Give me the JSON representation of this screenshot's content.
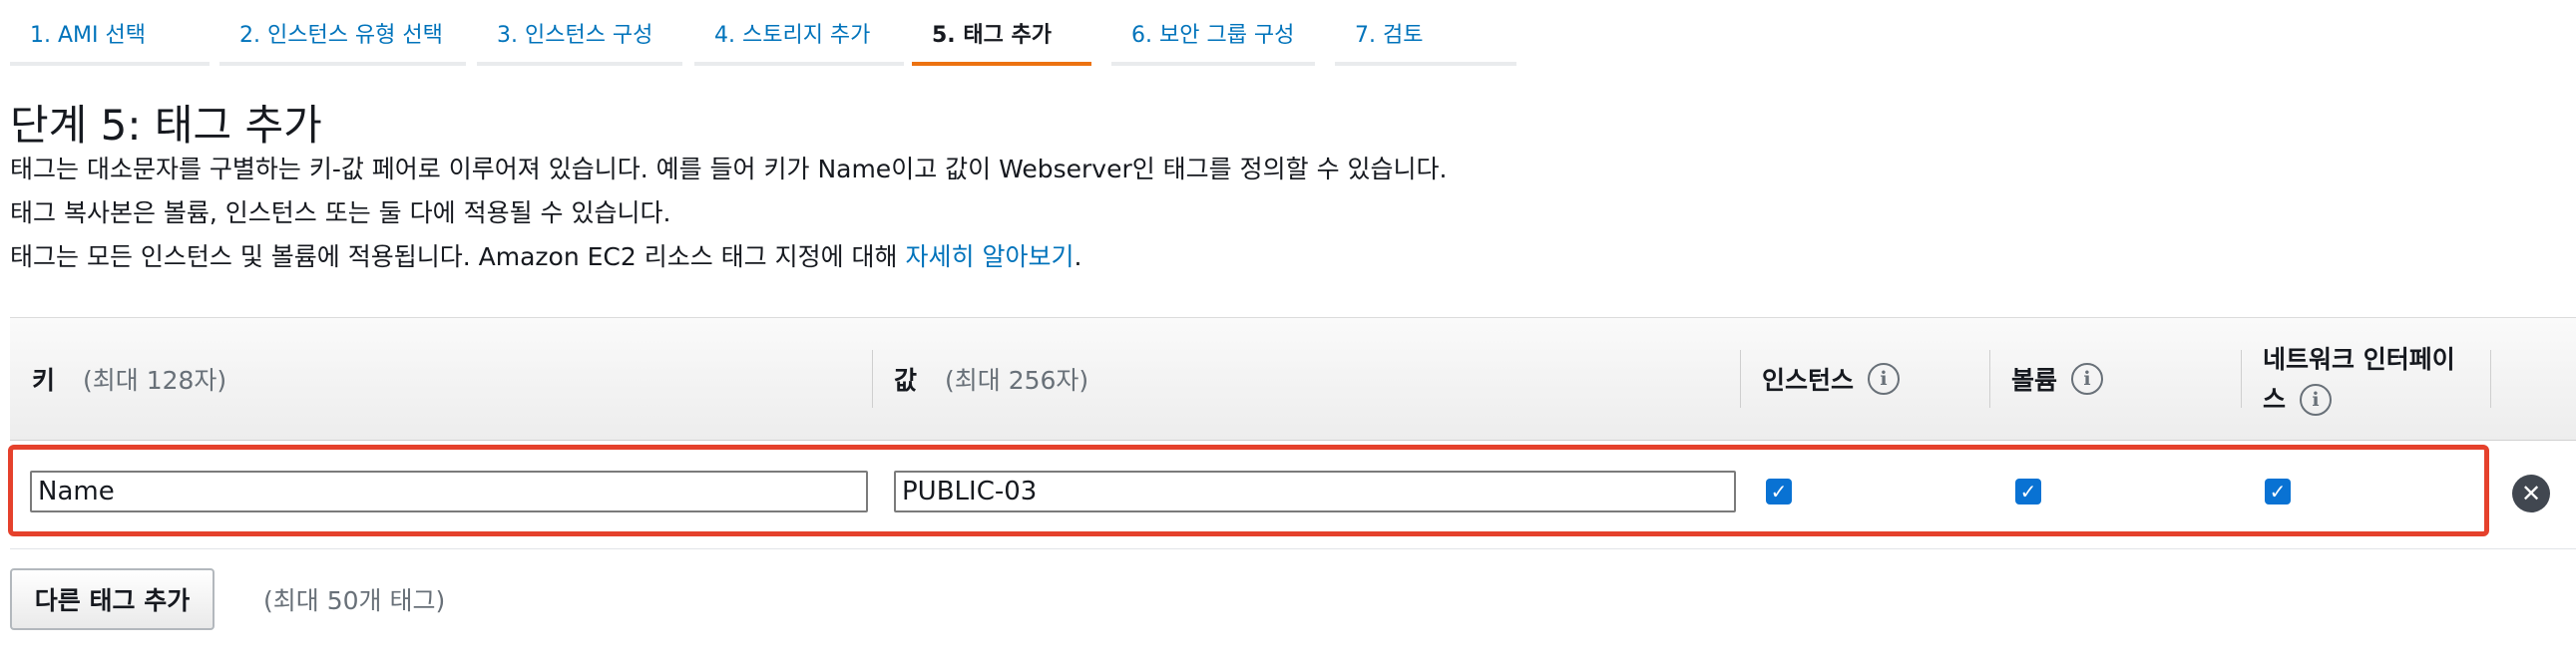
{
  "wizard": {
    "steps": [
      {
        "label": "1. AMI 선택"
      },
      {
        "label": "2. 인스턴스 유형 선택"
      },
      {
        "label": "3. 인스턴스 구성"
      },
      {
        "label": "4. 스토리지 추가"
      },
      {
        "label": "5. 태그 추가"
      },
      {
        "label": "6. 보안 그룹 구성"
      },
      {
        "label": "7. 검토"
      }
    ],
    "active_index": 4
  },
  "header": {
    "title": "단계 5: 태그 추가",
    "line1": "태그는 대소문자를 구별하는 키-값 페어로 이루어져 있습니다. 예를 들어 키가 Name이고 값이 Webserver인 태그를 정의할 수 있습니다.",
    "line2": "태그 복사본은 볼륨, 인스턴스 또는 둘 다에 적용될 수 있습니다.",
    "line3": "태그는 모든 인스턴스 및 볼륨에 적용됩니다. Amazon EC2 리소스 태그 지정에 대해",
    "learn_more": "자세히 알아보기",
    "line3_end": "."
  },
  "table": {
    "columns": {
      "key": {
        "label": "키",
        "hint": "(최대 128자)"
      },
      "value": {
        "label": "값",
        "hint": "(최대 256자)"
      },
      "instances": {
        "label": "인스턴스"
      },
      "volumes": {
        "label": "볼륨"
      },
      "network": {
        "label_line1": "네트워크 인터페이",
        "label_line2": "스"
      }
    },
    "rows": [
      {
        "key": "Name",
        "value": "PUBLIC-03",
        "instances": true,
        "volumes": true,
        "network": true
      }
    ]
  },
  "footer": {
    "add_tag_label": "다른 태그 추가",
    "limit_hint": "(최대 50개 태그)"
  },
  "colors": {
    "accent": "#ec7211",
    "link": "#0073bb",
    "highlight": "#e5412c",
    "checkbox": "#0972d3"
  },
  "icons": {
    "info": "info-icon",
    "remove": "remove-icon",
    "check": "check-icon"
  }
}
